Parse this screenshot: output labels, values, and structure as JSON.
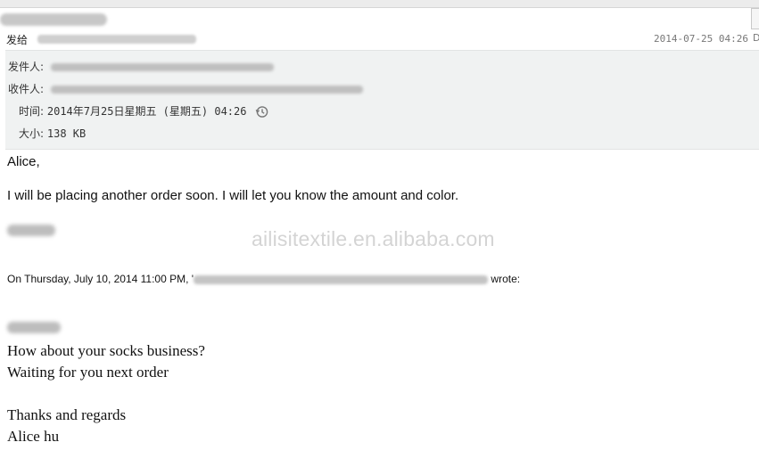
{
  "window": {
    "sent_to_label": "发给",
    "date": "2014-07-25 04:26",
    "date_icon_glyph": "D"
  },
  "header": {
    "from_label": "发件人:",
    "to_label": "收件人:",
    "time_label": "时间:",
    "time_value": "2014年7月25日星期五 (星期五) 04:26",
    "size_label": "大小:",
    "size_value": "138 KB",
    "panel_color": "#f0f2f2"
  },
  "body": {
    "greeting": "Alice,",
    "message": "I will be placing another order soon. I will let you know the amount and color.",
    "quote_prefix": "On Thursday, July 10, 2014 11:00 PM, '",
    "quote_suffix": "wrote:",
    "quoted_lines": [
      "How about your socks business?",
      "Waiting for you next order",
      "",
      "Thanks and regards",
      "Alice hu"
    ]
  },
  "watermark": "ailisitextile.en.alibaba.com",
  "icons": {
    "history": "clock-history-icon"
  }
}
